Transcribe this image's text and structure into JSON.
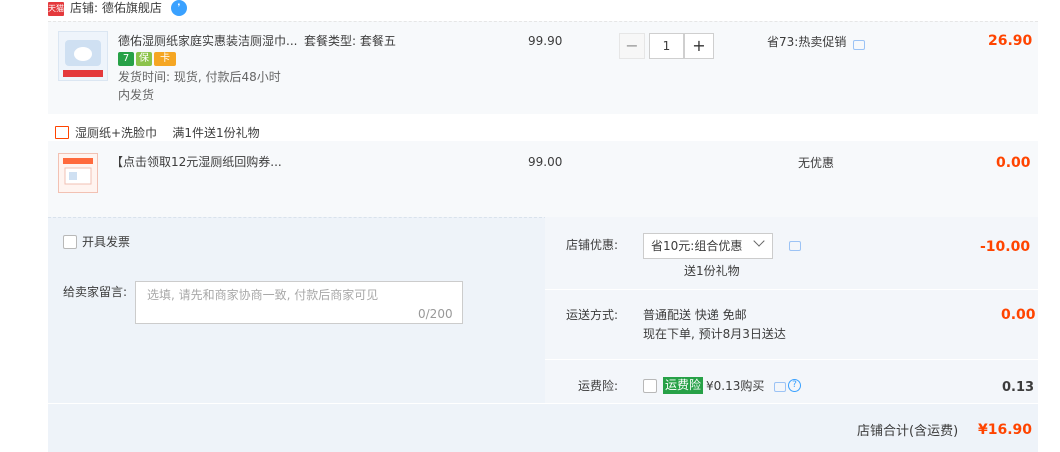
{
  "shop": {
    "badge": "天猫",
    "name": "店铺: 德佑旗舰店",
    "chat_icon": "chat-icon"
  },
  "items": [
    {
      "title": "德佑湿厕纸家庭实惠装洁厕湿巾...",
      "sku": "套餐类型: 套餐五",
      "tags": [
        "7",
        "保",
        "卡"
      ],
      "ship_line1": "发货时间: 现货, 付款后48小时",
      "ship_line2": "内发货",
      "price": "99.90",
      "quantity": "1",
      "promo": "省73:热卖促销",
      "total": "26.90"
    },
    {
      "title": "【点击领取12元湿厕纸回购券...",
      "price": "99.00",
      "promo": "无优惠",
      "total": "0.00"
    }
  ],
  "gift": {
    "text": "湿厕纸+洗脸巾    满1件送1份礼物"
  },
  "invoice": {
    "label": "开具发票"
  },
  "note": {
    "label": "给卖家留言:",
    "placeholder": "选填, 请先和商家协商一致, 付款后商家可见",
    "count": "0/200"
  },
  "discount": {
    "label": "店铺优惠:",
    "selected": "省10元:组合优惠",
    "gift": "送1份礼物",
    "amount": "-10.00"
  },
  "shipping": {
    "label": "运送方式:",
    "method": "普通配送 快递 免邮",
    "eta": "现在下单, 预计8月3日送达",
    "amount": "0.00"
  },
  "insurance": {
    "label": "运费险:",
    "badge": "运费险",
    "price": "¥0.13购买",
    "amount": "0.13"
  },
  "summary": {
    "label": "店铺合计(含运费)",
    "amount": "¥16.90"
  },
  "colors": {
    "accent_red": "#ff4400",
    "tmall_red": "#e4393c",
    "green": "#27a147",
    "link_blue": "#3aa1ff"
  }
}
